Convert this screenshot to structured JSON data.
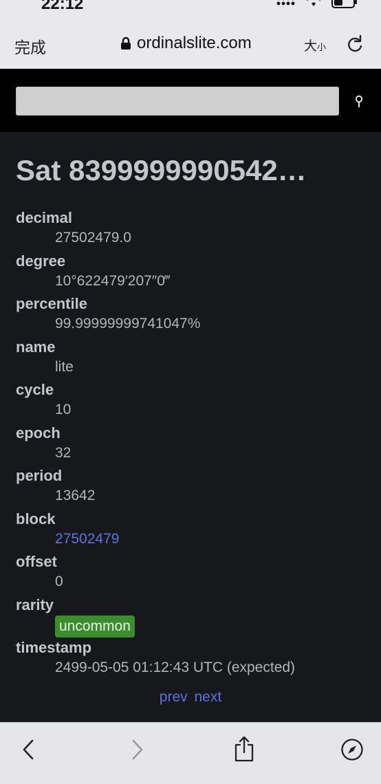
{
  "status": {
    "time": "22:12"
  },
  "browser": {
    "done_label": "完成",
    "url": "ordinalslite.com",
    "text_size_large": "大",
    "text_size_small": "小"
  },
  "search": {
    "value": "",
    "placeholder": ""
  },
  "page": {
    "title": "Sat 8399999990542…",
    "properties": [
      {
        "label": "decimal",
        "value": "27502479.0"
      },
      {
        "label": "degree",
        "value": "10°622479′207″0‴"
      },
      {
        "label": "percentile",
        "value": "99.99999999741047%"
      },
      {
        "label": "name",
        "value": "lite"
      },
      {
        "label": "cycle",
        "value": "10"
      },
      {
        "label": "epoch",
        "value": "32"
      },
      {
        "label": "period",
        "value": "13642"
      },
      {
        "label": "block",
        "value": "27502479"
      },
      {
        "label": "offset",
        "value": "0"
      },
      {
        "label": "rarity",
        "value": "uncommon"
      },
      {
        "label": "timestamp",
        "value": "2499-05-05 01:12:43 UTC (expected)"
      }
    ],
    "prev_label": "prev",
    "next_label": "next"
  },
  "colors": {
    "background": "#17181b",
    "link": "#5b74e0",
    "rarity_uncommon": "#3d8c2f",
    "header": "#000000"
  },
  "icons": {
    "lock": "lock-icon",
    "reload": "reload-icon",
    "search": "search-icon",
    "back": "chevron-left-icon",
    "forward": "chevron-right-icon",
    "share": "share-icon",
    "compass": "compass-icon"
  }
}
